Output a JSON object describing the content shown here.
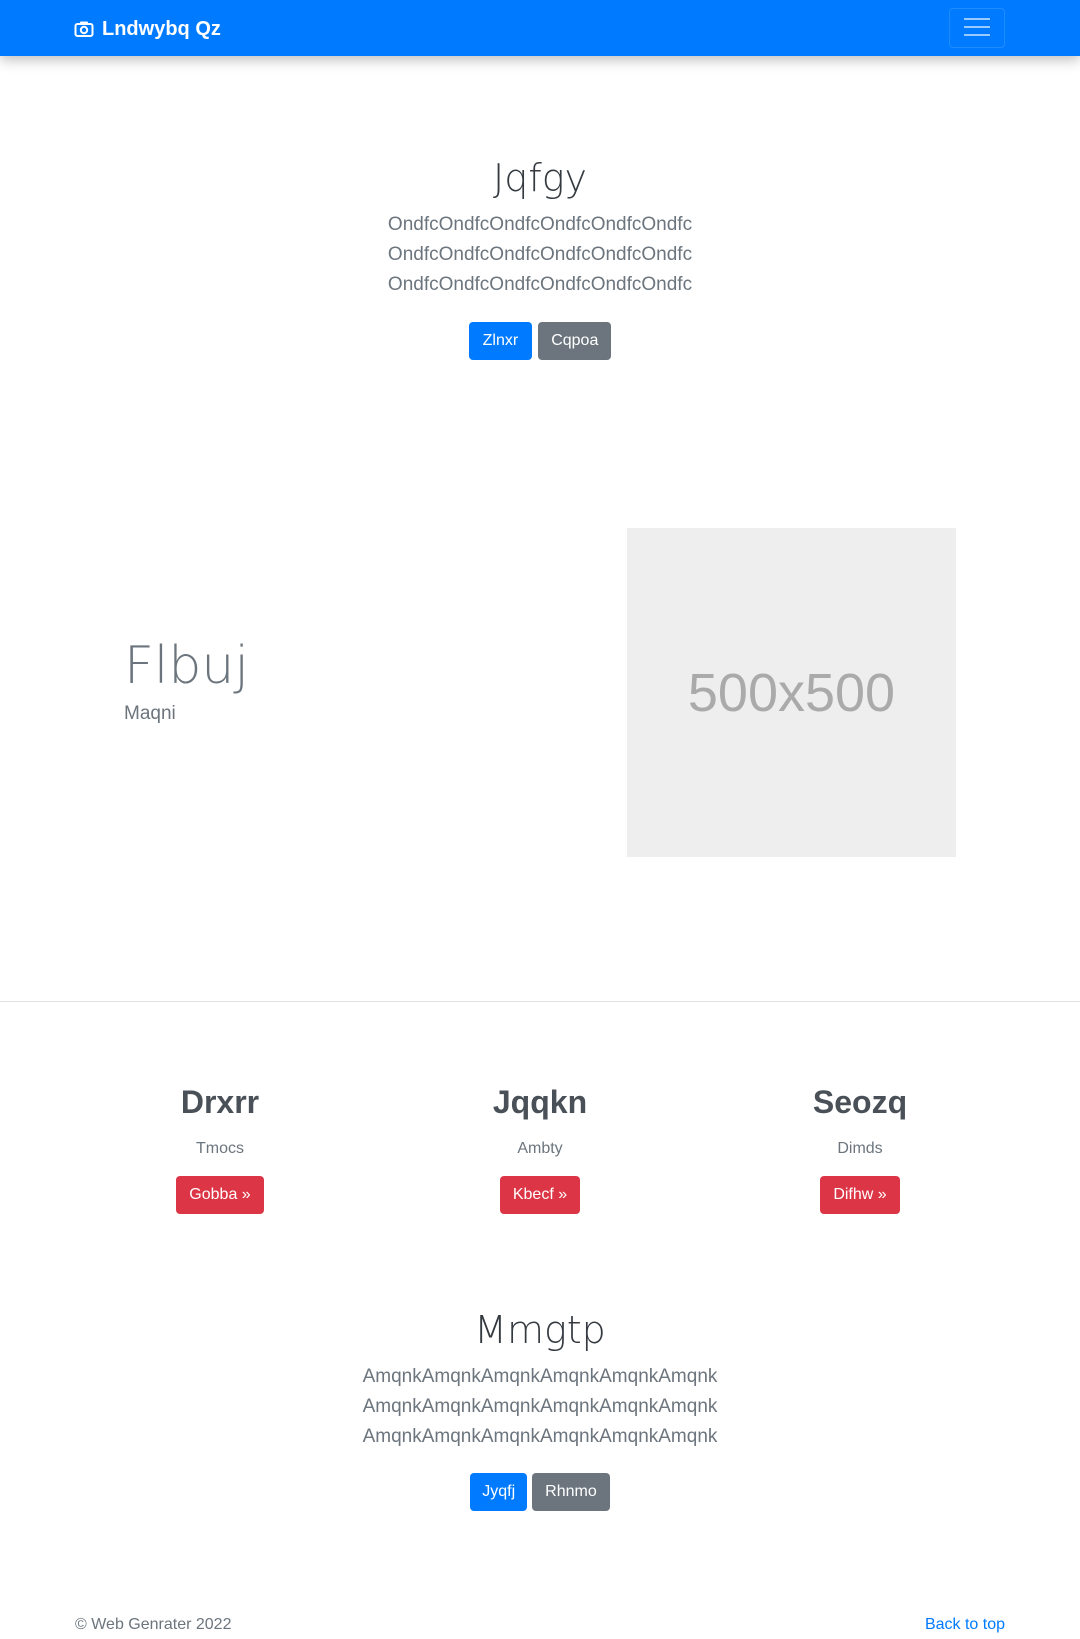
{
  "navbar": {
    "brand": "Lndwybq Qz",
    "brand_icon": "camera-icon",
    "toggler_icon": "hamburger-menu-icon",
    "background": "#007bff"
  },
  "hero": {
    "title": "Jqfgy",
    "lines": [
      "OndfcOndfcOndfcOndfcOndfcOndfc",
      "OndfcOndfcOndfcOndfcOndfcOndfc",
      "OndfcOndfcOndfcOndfcOndfcOndfc"
    ],
    "primary_button": "Zlnxr",
    "secondary_button": "Cqpoa"
  },
  "feature": {
    "title": "Flbuj",
    "subtitle": "Maqni",
    "image_label": "500x500"
  },
  "columns": [
    {
      "title": "Drxrr",
      "text": "Tmocs",
      "button": "Gobba »"
    },
    {
      "title": "Jqqkn",
      "text": "Ambty",
      "button": "Kbecf »"
    },
    {
      "title": "Seozq",
      "text": "Dimds",
      "button": "Difhw »"
    }
  ],
  "cta": {
    "title": "Mmgtp",
    "lines": [
      "AmqnkAmqnkAmqnkAmqnkAmqnkAmqnk",
      "AmqnkAmqnkAmqnkAmqnkAmqnkAmqnk",
      "AmqnkAmqnkAmqnkAmqnkAmqnkAmqnk"
    ],
    "primary_button": "Jyqfj",
    "secondary_button": "Rhnmo"
  },
  "footer": {
    "copyright": "© Web Genrater 2022",
    "back_to_top": "Back to top"
  },
  "colors": {
    "primary": "#007bff",
    "secondary": "#6c757d",
    "danger": "#dc3545",
    "placeholder_bg": "#eeeeee"
  }
}
